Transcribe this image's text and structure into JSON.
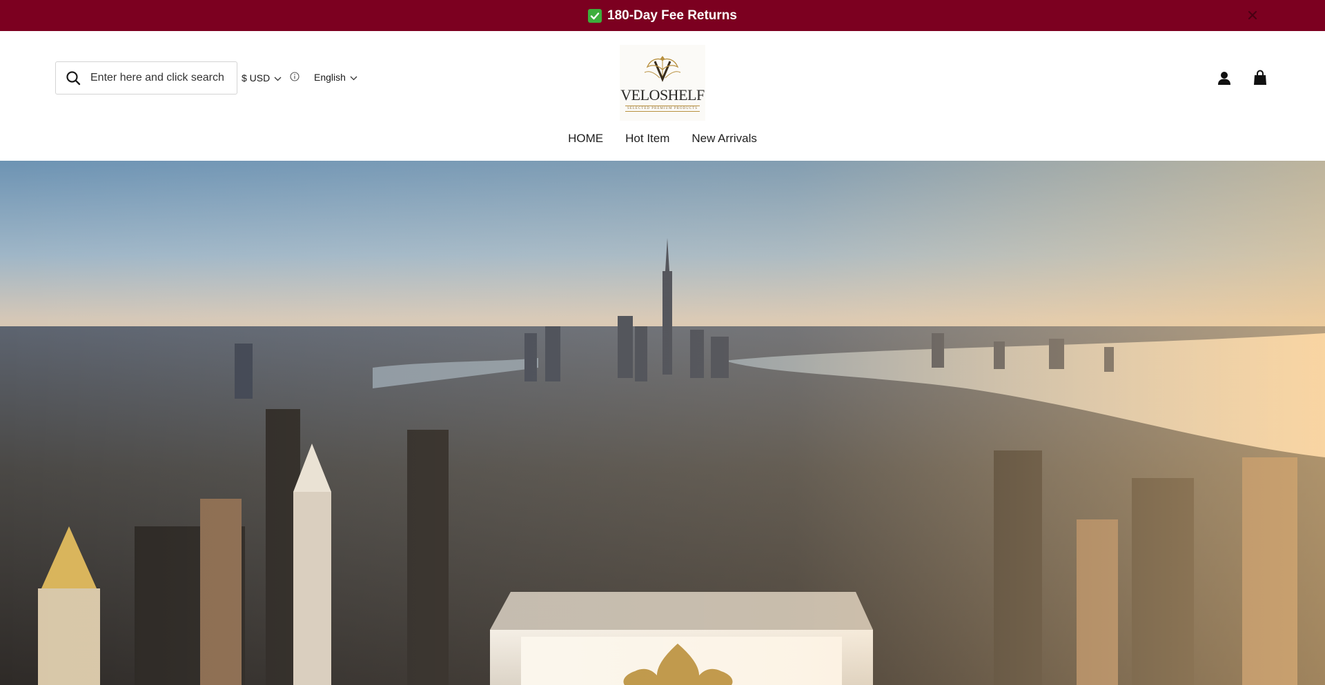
{
  "announcement": {
    "text": "180-Day Fee Returns",
    "icon": "check-mark-icon",
    "close_icon": "close-icon",
    "background": "#7c0020"
  },
  "header": {
    "search": {
      "placeholder": "Enter here and click search",
      "value": ""
    },
    "currency": {
      "label": "$ USD"
    },
    "language": {
      "label": "English"
    },
    "logo": {
      "name": "VELOSHELF",
      "tagline": "SELECTED PREMIUM PRODUCTS"
    },
    "icons": {
      "account": "account-icon",
      "cart": "cart-icon"
    }
  },
  "nav": {
    "items": [
      {
        "label": "HOME"
      },
      {
        "label": "Hot Item"
      },
      {
        "label": "New Arrivals"
      }
    ]
  },
  "hero": {
    "image": "city-skyline-sunset",
    "accent": "#b8903e"
  }
}
